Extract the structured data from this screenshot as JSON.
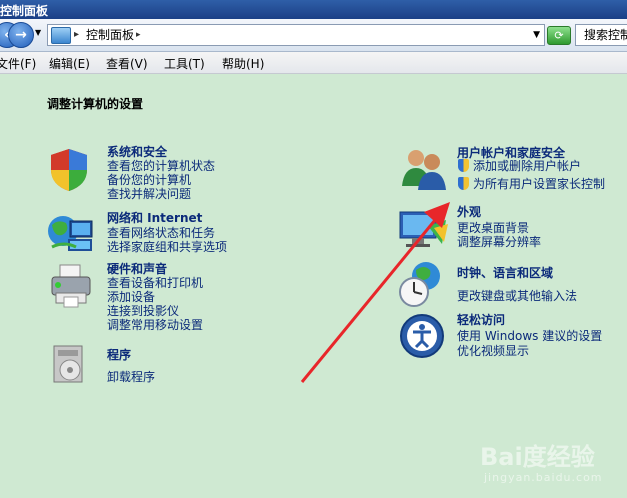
{
  "window": {
    "title": "控制面板"
  },
  "address_bar": {
    "path": "控制面板",
    "search_placeholder": "搜索控制"
  },
  "menu": [
    {
      "label": "文件(F)"
    },
    {
      "label": "编辑(E)"
    },
    {
      "label": "查看(V)"
    },
    {
      "label": "工具(T)"
    },
    {
      "label": "帮助(H)"
    }
  ],
  "heading": "调整计算机的设置",
  "categories": {
    "system_security": {
      "title": "系统和安全",
      "links": [
        "查看您的计算机状态",
        "备份您的计算机",
        "查找并解决问题"
      ]
    },
    "network": {
      "title": "网络和 Internet",
      "links": [
        "查看网络状态和任务",
        "选择家庭组和共享选项"
      ]
    },
    "hardware": {
      "title": "硬件和声音",
      "links": [
        "查看设备和打印机",
        "添加设备",
        "连接到投影仪",
        "调整常用移动设置"
      ]
    },
    "programs": {
      "title": "程序",
      "links": [
        "卸载程序"
      ]
    },
    "user_accounts": {
      "title": "用户帐户和家庭安全",
      "links": [
        "添加或删除用户帐户",
        "为所有用户设置家长控制"
      ]
    },
    "appearance": {
      "title": "外观",
      "links": [
        "更改桌面背景",
        "调整屏幕分辨率"
      ]
    },
    "clock_region": {
      "title": "时钟、语言和区域",
      "links": [
        "更改键盘或其他输入法"
      ]
    },
    "ease_access": {
      "title": "轻松访问",
      "links": [
        "使用 Windows 建议的设置",
        "优化视频显示"
      ]
    }
  },
  "watermark": {
    "text": "Bai度经验",
    "sub": "jingyan.baidu.com"
  },
  "colors": {
    "background": "#cfe9d2",
    "link": "#0b2a7a",
    "arrow": "#e8262a"
  }
}
